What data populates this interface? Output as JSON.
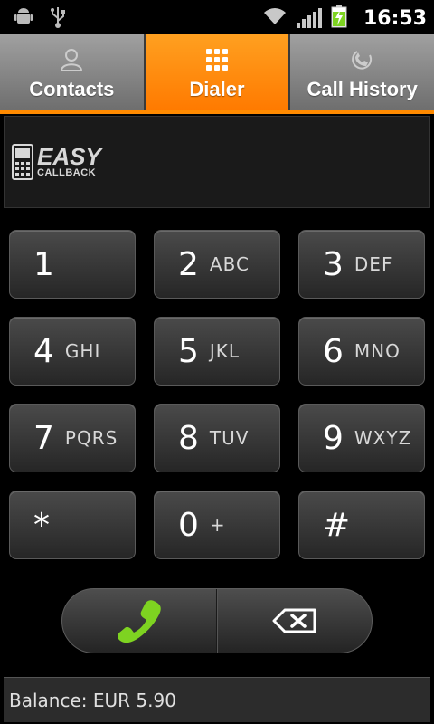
{
  "status_bar": {
    "time": "16:53",
    "icons": [
      "android-debug-icon",
      "usb-icon",
      "wifi-icon",
      "signal-icon",
      "battery-charging-icon"
    ]
  },
  "tabs": [
    {
      "label": "Contacts",
      "icon": "person-icon",
      "active": false
    },
    {
      "label": "Dialer",
      "icon": "keypad-grid-icon",
      "active": true
    },
    {
      "label": "Call History",
      "icon": "call-history-icon",
      "active": false
    }
  ],
  "banner": {
    "logo_main": "EASY",
    "logo_sub": "CALLBACK"
  },
  "keypad": {
    "keys": [
      {
        "digit": "1",
        "letters": ""
      },
      {
        "digit": "2",
        "letters": "ABC"
      },
      {
        "digit": "3",
        "letters": "DEF"
      },
      {
        "digit": "4",
        "letters": "GHI"
      },
      {
        "digit": "5",
        "letters": "JKL"
      },
      {
        "digit": "6",
        "letters": "MNO"
      },
      {
        "digit": "7",
        "letters": "PQRS"
      },
      {
        "digit": "8",
        "letters": "TUV"
      },
      {
        "digit": "9",
        "letters": "WXYZ"
      },
      {
        "digit": "*",
        "letters": ""
      },
      {
        "digit": "0",
        "letters": "+"
      },
      {
        "digit": "#",
        "letters": ""
      }
    ]
  },
  "actions": {
    "call_icon": "phone-handset-icon",
    "delete_icon": "backspace-icon"
  },
  "balance": {
    "text": "Balance: EUR 5.90"
  },
  "colors": {
    "accent": "#ff8a00",
    "call_green": "#7ed321"
  }
}
